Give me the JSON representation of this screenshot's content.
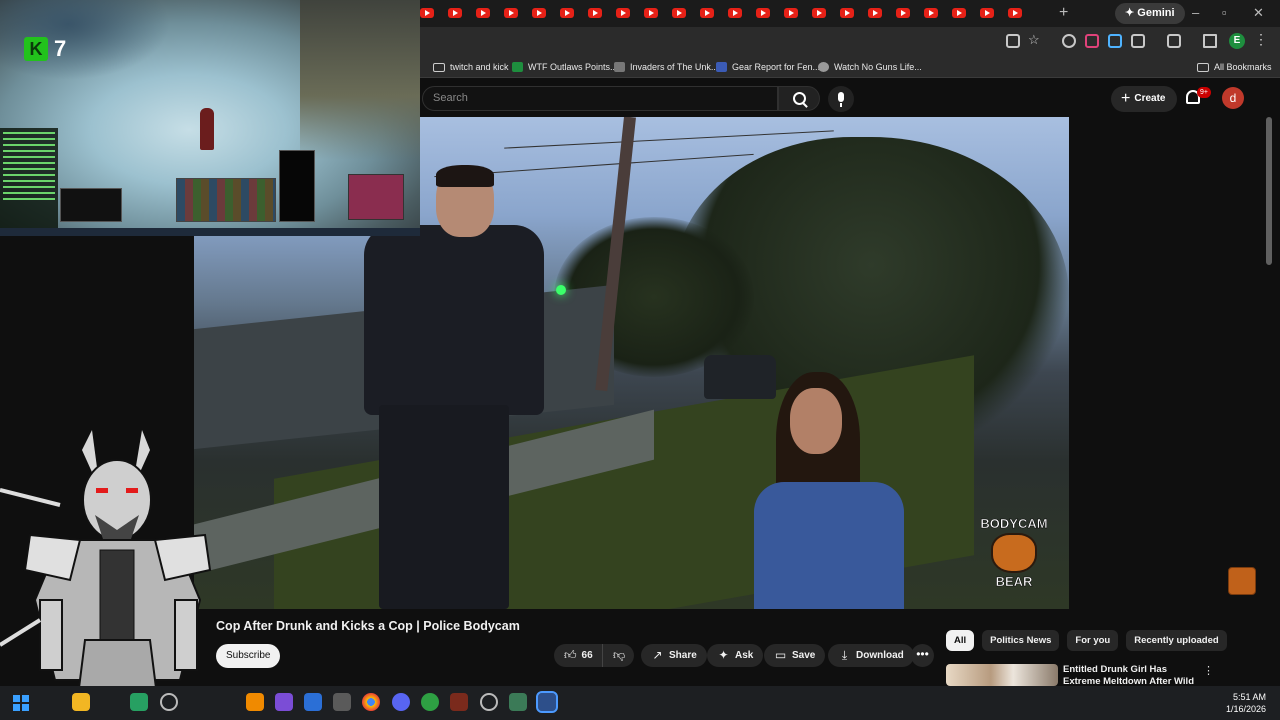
{
  "browser": {
    "gemini_label": "Gemini",
    "bookmarks": [
      {
        "label": "twitch and kick",
        "icon": "folder-icon"
      },
      {
        "label": "WTF Outlaws Points...",
        "icon": "sheets-icon"
      },
      {
        "label": "Invaders of The Unk...",
        "icon": "site-icon"
      },
      {
        "label": "Gear Report for Fen...",
        "icon": "site-icon"
      },
      {
        "label": "Watch No Guns Life...",
        "icon": "site-icon"
      }
    ],
    "all_bookmarks": "All Bookmarks"
  },
  "youtube": {
    "search_placeholder": "Search",
    "create_label": "Create",
    "notification_badge": "9+",
    "avatar_letter": "d"
  },
  "video": {
    "title": "Cop After Drunk and Kicks a Cop | Police Bodycam",
    "title_prefix": "K",
    "watermark_line1": "BODYCAM",
    "watermark_line2": "BEAR",
    "subscribe_label": "Subscribe",
    "likes": "66",
    "share_label": "Share",
    "ask_label": "Ask",
    "save_label": "Save",
    "download_label": "Download"
  },
  "chips": [
    "All",
    "Politics News",
    "For you",
    "Recently uploaded"
  ],
  "recommendation": {
    "title": "Entitled Drunk Girl Has Extreme Meltdown After Wild Night"
  },
  "game_overlay": {
    "kill_badge": "K",
    "kill_count": "7"
  },
  "taskbar": {
    "time": "5:51 AM",
    "date": "1/16/2026"
  },
  "colors": {
    "youtube_red": "#e62117",
    "youtube_bg": "#0f0f0f",
    "chip_active": "#f1f1f1"
  }
}
